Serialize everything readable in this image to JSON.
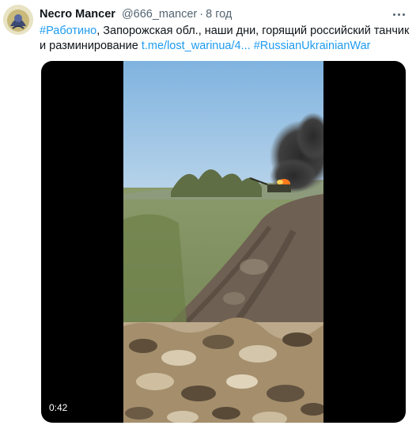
{
  "author": {
    "display_name": "Necro Mancer",
    "handle": "@666_mancer",
    "separator": "·",
    "time": "8 год"
  },
  "tweet": {
    "hashtag_1": "#Работино",
    "text_1": ", Запорожская обл., наши дни, горящий российский танчик и разминирование ",
    "link": "t.me/lost_warinua/4...",
    "space": " ",
    "hashtag_2": "#RussianUkrainianWar"
  },
  "media": {
    "duration": "0:42"
  },
  "icons": {
    "more": "more-horizontal-icon",
    "avatar": "avatar-image"
  },
  "colors": {
    "link": "#1d9bf0",
    "secondary_text": "#536471",
    "media_background": "#000000"
  }
}
